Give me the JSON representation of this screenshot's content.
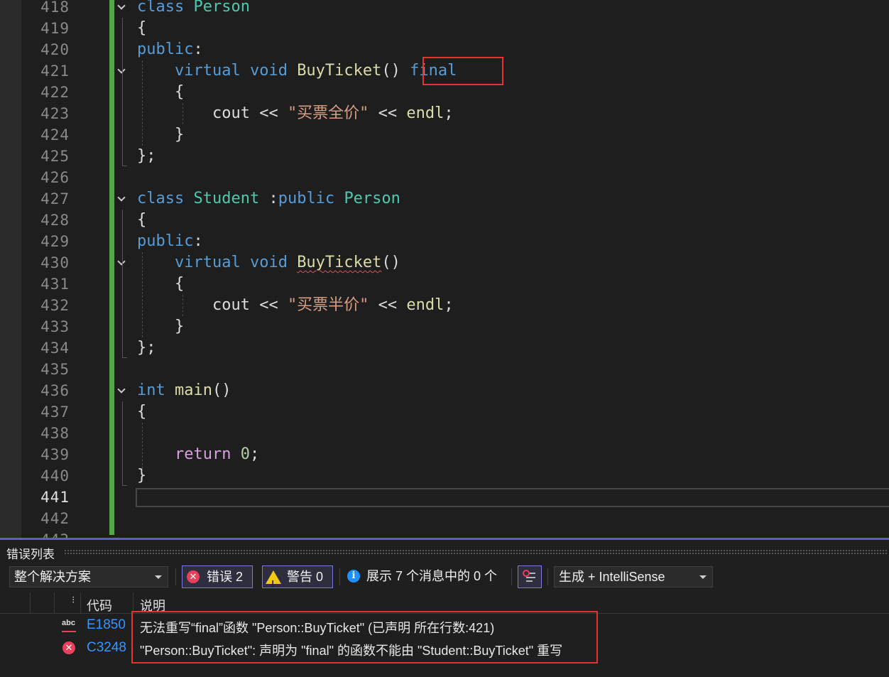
{
  "editor": {
    "lines": [
      {
        "num": "418",
        "tokens": [
          {
            "t": "class",
            "c": "kw"
          },
          {
            "t": " "
          },
          {
            "t": "Person",
            "c": "ty"
          }
        ]
      },
      {
        "num": "419",
        "tokens": [
          {
            "t": "{"
          }
        ]
      },
      {
        "num": "420",
        "tokens": [
          {
            "t": "public",
            "c": "kw"
          },
          {
            "t": ":"
          }
        ]
      },
      {
        "num": "421",
        "tokens": [
          {
            "t": "    "
          },
          {
            "t": "virtual",
            "c": "kw"
          },
          {
            "t": " "
          },
          {
            "t": "void",
            "c": "kw"
          },
          {
            "t": " "
          },
          {
            "t": "BuyTicket",
            "c": "fn"
          },
          {
            "t": "() "
          },
          {
            "t": "final",
            "c": "kw"
          }
        ]
      },
      {
        "num": "422",
        "tokens": [
          {
            "t": "    {"
          }
        ]
      },
      {
        "num": "423",
        "tokens": [
          {
            "t": "        "
          },
          {
            "t": "cout",
            "c": ""
          },
          {
            "t": " << "
          },
          {
            "t": "\"买票全价\"",
            "c": "st"
          },
          {
            "t": " << "
          },
          {
            "t": "endl",
            "c": "fn"
          },
          {
            "t": ";"
          }
        ]
      },
      {
        "num": "424",
        "tokens": [
          {
            "t": "    }"
          }
        ]
      },
      {
        "num": "425",
        "tokens": [
          {
            "t": "};"
          }
        ]
      },
      {
        "num": "426",
        "tokens": []
      },
      {
        "num": "427",
        "tokens": [
          {
            "t": "class",
            "c": "kw"
          },
          {
            "t": " "
          },
          {
            "t": "Student",
            "c": "ty"
          },
          {
            "t": " :"
          },
          {
            "t": "public",
            "c": "kw"
          },
          {
            "t": " "
          },
          {
            "t": "Person",
            "c": "ty"
          }
        ]
      },
      {
        "num": "428",
        "tokens": [
          {
            "t": "{"
          }
        ]
      },
      {
        "num": "429",
        "tokens": [
          {
            "t": "public",
            "c": "kw"
          },
          {
            "t": ":"
          }
        ]
      },
      {
        "num": "430",
        "tokens": [
          {
            "t": "    "
          },
          {
            "t": "virtual",
            "c": "kw"
          },
          {
            "t": " "
          },
          {
            "t": "void",
            "c": "kw"
          },
          {
            "t": " "
          },
          {
            "t": "BuyTicket",
            "c": "fn sq"
          },
          {
            "t": "()"
          }
        ]
      },
      {
        "num": "431",
        "tokens": [
          {
            "t": "    {"
          }
        ]
      },
      {
        "num": "432",
        "tokens": [
          {
            "t": "        "
          },
          {
            "t": "cout",
            "c": ""
          },
          {
            "t": " << "
          },
          {
            "t": "\"买票半价\"",
            "c": "st"
          },
          {
            "t": " << "
          },
          {
            "t": "endl",
            "c": "fn"
          },
          {
            "t": ";"
          }
        ]
      },
      {
        "num": "433",
        "tokens": [
          {
            "t": "    }"
          }
        ]
      },
      {
        "num": "434",
        "tokens": [
          {
            "t": "};"
          }
        ]
      },
      {
        "num": "435",
        "tokens": []
      },
      {
        "num": "436",
        "tokens": [
          {
            "t": "int",
            "c": "kw"
          },
          {
            "t": " "
          },
          {
            "t": "main",
            "c": "fn"
          },
          {
            "t": "()"
          }
        ]
      },
      {
        "num": "437",
        "tokens": [
          {
            "t": "{"
          }
        ]
      },
      {
        "num": "438",
        "tokens": []
      },
      {
        "num": "439",
        "tokens": [
          {
            "t": "    "
          },
          {
            "t": "return",
            "c": "pp"
          },
          {
            "t": " "
          },
          {
            "t": "0",
            "c": "nm"
          },
          {
            "t": ";"
          }
        ]
      },
      {
        "num": "440",
        "tokens": [
          {
            "t": "}"
          }
        ]
      },
      {
        "num": "441",
        "tokens": []
      },
      {
        "num": "442",
        "tokens": []
      },
      {
        "num": "443",
        "tokens": []
      }
    ],
    "current_line": "441",
    "fold_lines": [
      "418",
      "421",
      "427",
      "430",
      "436"
    ]
  },
  "error_list": {
    "title": "错误列表",
    "scope_combo": "整个解决方案",
    "errors_button": "错误 2",
    "warnings_button": "警告 0",
    "messages_button": "展示 7 个消息中的 0 个",
    "build_combo": "生成 + IntelliSense",
    "columns": {
      "code": "代码",
      "description": "说明"
    },
    "rows": [
      {
        "code": "E1850",
        "icon": "spell-abc-icon",
        "description": "无法重写“final”函数 \"Person::BuyTicket\" (已声明 所在行数:421)"
      },
      {
        "code": "C3248",
        "icon": "error-icon",
        "description": "\"Person::BuyTicket\": 声明为 \"final\" 的函数不能由 \"Student::BuyTicket\" 重写"
      }
    ],
    "colors": {
      "error": "#e8405a",
      "warning": "#f2c811",
      "info": "#1e90ff",
      "accent": "#5b5fc7",
      "highlight_box": "#e8312f"
    }
  }
}
